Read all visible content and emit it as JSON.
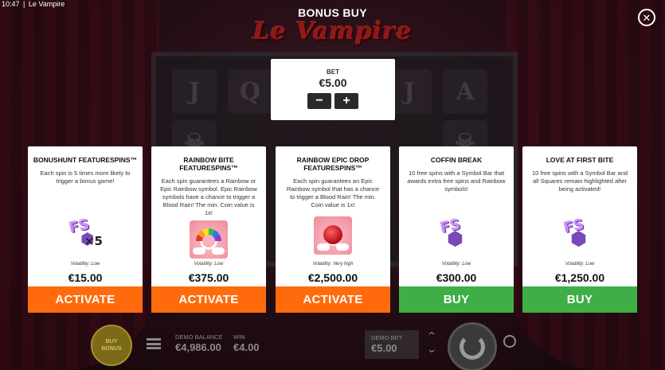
{
  "status_bar": {
    "time": "10:47",
    "separator": "|",
    "app_name": "Le Vampire"
  },
  "game_logo": "Le Vampire",
  "dialog_title": "BONUS BUY",
  "bet": {
    "label": "BET",
    "value": "€5.00",
    "decrease": "−",
    "increase": "+"
  },
  "cards": [
    {
      "title": "BONUSHUNT FEATURESPINS™",
      "description": "Each spin is 5 times more likely to trigger a bonus game!",
      "icon": "featurespins-x5-icon",
      "volatility": "Volatility: Low",
      "price": "€15.00",
      "action": "ACTIVATE",
      "action_color": "#ff6b0c"
    },
    {
      "title": "RAINBOW BITE FEATURESPINS™",
      "description": "Each spin guarantees a Rainbow or Epic Rainbow symbol. Epic Rainbow symbols have a chance to trigger a Blood Rain! The min. Coin value is 1x!",
      "icon": "rainbow-symbol-icon",
      "volatility": "Volatility: Low",
      "price": "€375.00",
      "action": "ACTIVATE",
      "action_color": "#ff6b0c"
    },
    {
      "title": "RAINBOW EPIC DROP FEATURESPINS™",
      "description": "Each spin guarantees an Epic Rainbow symbol that has a chance to trigger a Blood Rain! The min. Coin value is 1x!",
      "icon": "epic-rainbow-symbol-icon",
      "volatility": "Volatility: Very high",
      "price": "€2,500.00",
      "action": "ACTIVATE",
      "action_color": "#ff6b0c"
    },
    {
      "title": "COFFIN BREAK",
      "description": "10 free spins with a Symbol Bar that awards extra free spins and Rainbow symbols!",
      "icon": "free-spins-icon",
      "volatility": "Volatility: Low",
      "price": "€300.00",
      "action": "BUY",
      "action_color": "#3fae46"
    },
    {
      "title": "LOVE AT FIRST BITE",
      "description": "10 free spins with a Symbol Bar and all Squares remain highlighted after being activated!",
      "icon": "free-spins-icon",
      "volatility": "Volatility: Low",
      "price": "€1,250.00",
      "action": "BUY",
      "action_color": "#3fae46"
    }
  ],
  "bottom_bar": {
    "buy_bonus": "BUY BONUS",
    "demo_balance_label": "DEMO BALANCE",
    "demo_balance_value": "€4,986.00",
    "win_label": "WIN",
    "win_value": "€4.00",
    "demo_bet_label": "DEMO BET",
    "demo_bet_value": "€5.00"
  },
  "colors": {
    "activate": "#ff6b0c",
    "buy": "#3fae46",
    "panel": "#ffffff"
  }
}
